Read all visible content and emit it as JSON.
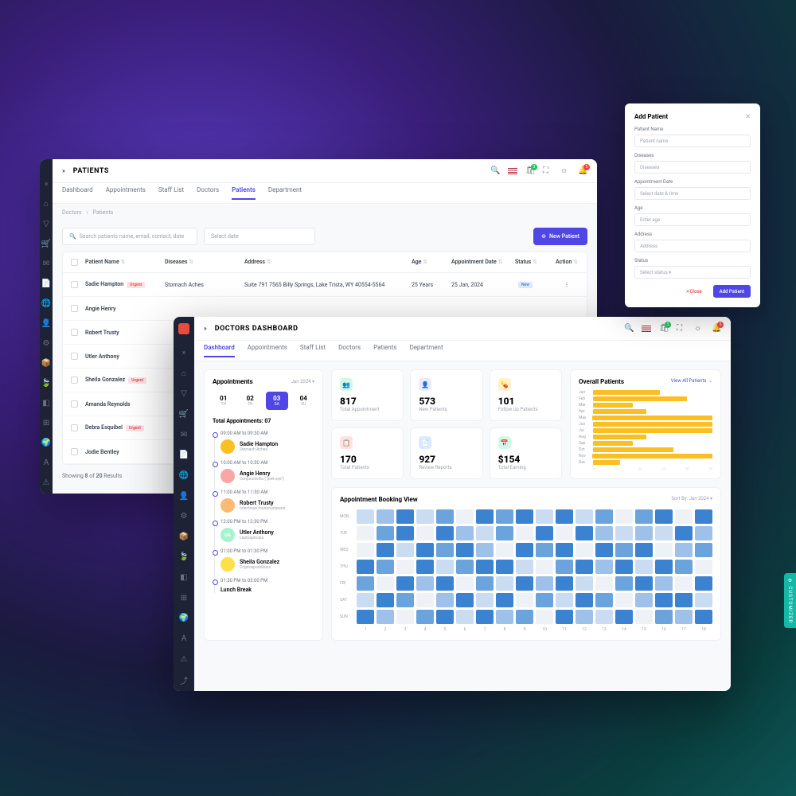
{
  "patients_window": {
    "title": "PATIENTS",
    "tabs": [
      "Dashboard",
      "Appointments",
      "Staff List",
      "Doctors",
      "Patients",
      "Department"
    ],
    "active_tab": 4,
    "breadcrumb": [
      "Doctors",
      "Patients"
    ],
    "search_placeholder": "Search patients name, email, contact, date",
    "date_placeholder": "Select date",
    "new_patient_btn": "New Patient",
    "columns": [
      "Patient Name",
      "Diseases",
      "Address",
      "Age",
      "Appointment Date",
      "Status",
      "Action"
    ],
    "rows": [
      {
        "name": "Sadie Hampton",
        "tag": "Urgent",
        "disease": "Stomach Aches",
        "address": "Suite 791 7565 Billy Springs, Lake Trista, WY 40554-5564",
        "age": "25 Years",
        "date": "25 Jan, 2024",
        "status": "New"
      },
      {
        "name": "Angie Henry",
        "disease": "",
        "address": "",
        "age": "",
        "date": ""
      },
      {
        "name": "Robert Trusty"
      },
      {
        "name": "Utler Anthony"
      },
      {
        "name": "Sheila Gonzalez",
        "tag": "Urgent"
      },
      {
        "name": "Amanda Reynolds"
      },
      {
        "name": "Debra Esquibel",
        "tag": "Urgent"
      },
      {
        "name": "Jodie Bentley"
      }
    ],
    "footer": {
      "showing": "Showing",
      "count": "8",
      "of": "of",
      "total": "20",
      "results": "Results"
    }
  },
  "dashboard_window": {
    "title": "DOCTORS DASHBOARD",
    "tabs": [
      "Dashboard",
      "Appointments",
      "Staff List",
      "Doctors",
      "Patients",
      "Department"
    ],
    "active_tab": 0,
    "appointments": {
      "title": "Appointments",
      "month": "Jan 2024",
      "days": [
        {
          "n": "01",
          "l": "TH"
        },
        {
          "n": "02",
          "l": "FR"
        },
        {
          "n": "03",
          "l": "SA"
        },
        {
          "n": "04",
          "l": "SU"
        }
      ],
      "active_day": 2,
      "total_label": "Total Appointments: 07",
      "slots": [
        {
          "time": "09:00 AM to 09:30 AM",
          "name": "Sadie Hampton",
          "sub": "Stomach Aches",
          "color": "#fbbf24"
        },
        {
          "time": "10:00 AM to 10:30 AM",
          "name": "Angie Henry",
          "sub": "Conjunctivitis (\"pink eye\")",
          "color": "#fca5a5"
        },
        {
          "time": "11:00 AM to 11:30 AM",
          "name": "Robert Trusty",
          "sub": "Infectious mononucleosis",
          "color": "#fdba74"
        },
        {
          "time": "12:00 PM to 12:30 PM",
          "name": "Utler Anthony",
          "sub": "Leptospirosis",
          "initials": "UA",
          "color": "#a7f3d0"
        },
        {
          "time": "01:00 PM to 01:30 PM",
          "name": "Sheila Gonzalez",
          "sub": "Cryptosporidiosis",
          "color": "#fde047"
        },
        {
          "time": "01:30 PM to 03:00 PM",
          "name": "Lunch Break",
          "sub": ""
        }
      ]
    },
    "stats": [
      {
        "num": "817",
        "label": "Total Appointment",
        "icon": "👥",
        "bg": "#d1fae5"
      },
      {
        "num": "573",
        "label": "New Patients",
        "icon": "👤",
        "bg": "#ede9fe"
      },
      {
        "num": "101",
        "label": "Follow Up Patients",
        "icon": "💊",
        "bg": "#fef3c7"
      },
      {
        "num": "170",
        "label": "Total Patients",
        "icon": "📋",
        "bg": "#fee2e2"
      },
      {
        "num": "927",
        "label": "Review Reports",
        "icon": "📄",
        "bg": "#dbeafe"
      },
      {
        "num": "$154",
        "label": "Total Earning",
        "icon": "📅",
        "bg": "#d1fae5"
      }
    ],
    "overall": {
      "title": "Overall Patients",
      "link": "View All Patients →"
    },
    "booking": {
      "title": "Appointment Booking View",
      "sort_label": "Sort By:",
      "sort_value": "Jan 2024"
    }
  },
  "chart_data": {
    "type": "bar",
    "title": "Overall Patients",
    "categories": [
      "Jan",
      "Feb",
      "Mar",
      "Apr",
      "May",
      "Jun",
      "Jul",
      "Aug",
      "Sep",
      "Oct",
      "Nov",
      "Dec"
    ],
    "values": [
      25,
      35,
      15,
      20,
      48,
      45,
      45,
      20,
      15,
      30,
      48,
      10
    ],
    "xlabel": "",
    "ylabel": "",
    "xlim": [
      0,
      50
    ],
    "xticks": [
      0,
      10,
      20,
      30,
      40,
      50
    ]
  },
  "heatmap_data": {
    "type": "heatmap",
    "title": "Appointment Booking View",
    "ylabels": [
      "MON",
      "TUE",
      "WED",
      "THU",
      "FRI",
      "SAT",
      "SUN"
    ],
    "xlabels": [
      "1",
      "2",
      "3",
      "4",
      "5",
      "6",
      "7",
      "8",
      "9",
      "10",
      "11",
      "12",
      "13",
      "14",
      "15",
      "16",
      "17",
      "18"
    ],
    "colors": [
      "#eef2f7",
      "#c9dcf2",
      "#9dc1e8",
      "#6ba3dd",
      "#3b82d0"
    ],
    "grid": [
      [
        1,
        2,
        4,
        1,
        3,
        0,
        4,
        3,
        4,
        1,
        4,
        1,
        3,
        0,
        3,
        4,
        0,
        4
      ],
      [
        0,
        3,
        4,
        0,
        4,
        2,
        1,
        3,
        0,
        4,
        0,
        4,
        2,
        1,
        2,
        1,
        4,
        2
      ],
      [
        0,
        4,
        1,
        4,
        3,
        4,
        2,
        0,
        4,
        3,
        4,
        0,
        4,
        3,
        4,
        0,
        2,
        3
      ],
      [
        4,
        3,
        0,
        4,
        1,
        3,
        4,
        4,
        1,
        0,
        3,
        4,
        2,
        4,
        1,
        4,
        3,
        0
      ],
      [
        3,
        0,
        4,
        2,
        4,
        0,
        3,
        1,
        4,
        2,
        4,
        1,
        0,
        3,
        4,
        2,
        0,
        4
      ],
      [
        1,
        4,
        3,
        0,
        2,
        4,
        1,
        4,
        0,
        3,
        1,
        4,
        3,
        0,
        2,
        4,
        4,
        1
      ],
      [
        4,
        2,
        0,
        3,
        4,
        1,
        4,
        2,
        3,
        0,
        4,
        2,
        1,
        4,
        0,
        3,
        2,
        4
      ]
    ]
  },
  "modal": {
    "title": "Add Patient",
    "fields": [
      {
        "label": "Patient Name",
        "placeholder": "Patient name"
      },
      {
        "label": "Diseases",
        "placeholder": "Diseases"
      },
      {
        "label": "Appointment Date",
        "placeholder": "Select date & time"
      },
      {
        "label": "Age",
        "placeholder": "Enter age"
      },
      {
        "label": "Address",
        "placeholder": "Address"
      },
      {
        "label": "Status",
        "placeholder": "Select status"
      }
    ],
    "close_btn": "Close",
    "add_btn": "Add Patient"
  },
  "customizer": "⚙ CUSTOMIZER"
}
